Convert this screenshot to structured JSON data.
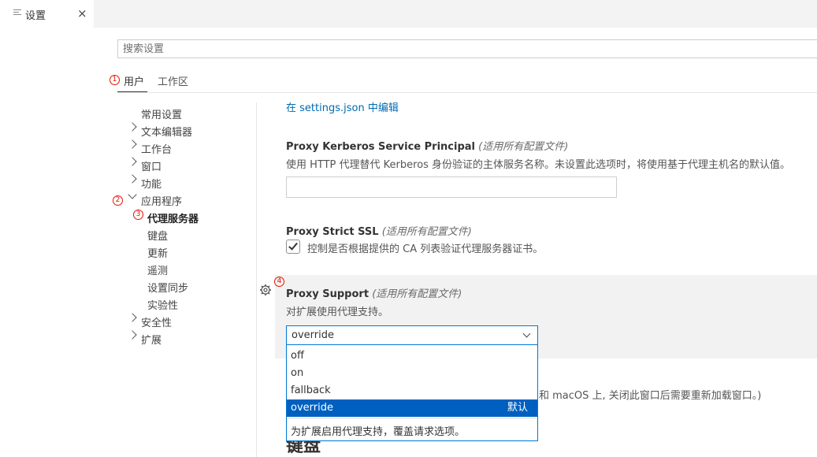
{
  "tab": {
    "title": "设置",
    "close": "×"
  },
  "search": {
    "placeholder": "搜索设置"
  },
  "markers": {
    "m1": "1",
    "m2": "2",
    "m3": "3",
    "m4": "4"
  },
  "scope": {
    "user": "用户",
    "workspace": "工作区"
  },
  "toc": {
    "common": "常用设置",
    "text_editor": "文本编辑器",
    "workbench": "工作台",
    "window": "窗口",
    "features": "功能",
    "application": "应用程序",
    "proxy": "代理服务器",
    "keyboard": "键盘",
    "update": "更新",
    "telemetry": "遥测",
    "settings_sync": "设置同步",
    "experimental": "实验性",
    "security": "安全性",
    "extensions": "扩展"
  },
  "link": "在 settings.json 中编辑",
  "kerberos": {
    "title": "Proxy Kerberos Service Principal",
    "scope": "(适用所有配置文件)",
    "desc": "使用 HTTP 代理替代 Kerberos 身份验证的主体服务名称。未设置此选项时，将使用基于代理主机名的默认值。",
    "value": ""
  },
  "strict_ssl": {
    "title": "Proxy Strict SSL",
    "scope": "(适用所有配置文件)",
    "desc": "控制是否根据提供的 CA 列表验证代理服务器证书。",
    "checked": true
  },
  "proxy_support": {
    "title": "Proxy Support",
    "scope": "(适用所有配置文件)",
    "desc": "对扩展使用代理支持。",
    "value": "override",
    "options": [
      "off",
      "on",
      "fallback",
      "override"
    ],
    "default_label": "默认",
    "option_desc": "为扩展启用代理支持，覆盖请求选项。"
  },
  "behind": {
    "partial_text": "和 macOS 上, 关闭此窗口后需要重新加载窗口。)",
    "partial_heading": "键盘"
  },
  "colors": {
    "accent": "#0078d4",
    "selection": "#0060c0",
    "marker": "#e51400",
    "link": "#006ab1"
  }
}
